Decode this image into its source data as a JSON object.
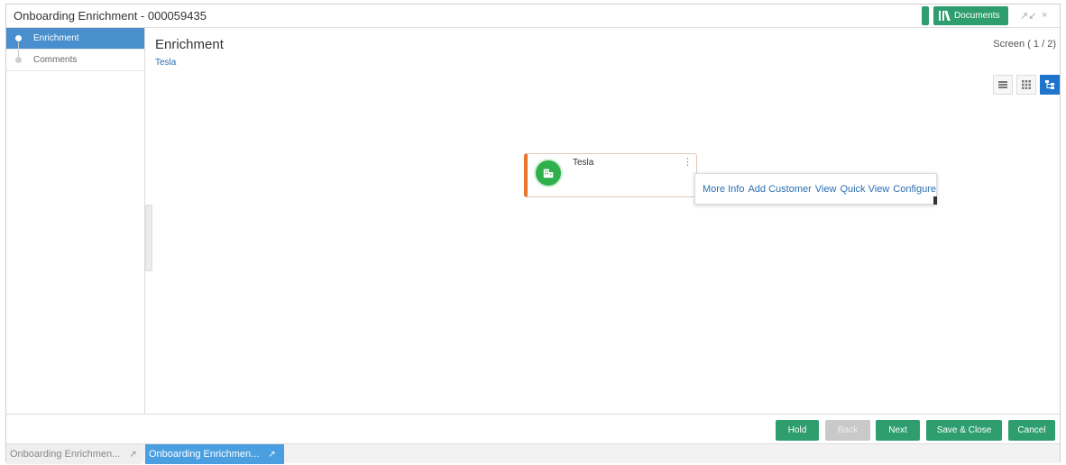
{
  "window": {
    "title": "Onboarding Enrichment - 000059435",
    "documents_label": "Documents",
    "minimize_glyph": "↗↙",
    "close_glyph": "×"
  },
  "sidebar": {
    "items": [
      {
        "label": "Enrichment",
        "active": true
      },
      {
        "label": "Comments",
        "active": false
      }
    ]
  },
  "main": {
    "title": "Enrichment",
    "subtitle": "Tesla",
    "screen_count": "Screen ( 1 / 2)",
    "view_toggle": [
      "list-view-icon",
      "grid-view-icon",
      "tree-view-icon"
    ],
    "node": {
      "label": "Tesla",
      "kebab": "⋮",
      "icon": "building-icon"
    },
    "context_menu": [
      "More Info",
      "Add Customer",
      "View",
      "Quick View",
      "Configure"
    ]
  },
  "footer": {
    "buttons": [
      "Hold",
      "Back",
      "Next",
      "Save & Close",
      "Cancel"
    ]
  },
  "taskbar": {
    "tasks": [
      "Onboarding Enrichmen...",
      "Onboarding Enrichmen..."
    ]
  },
  "colors": {
    "primary_green": "#2e9e6f",
    "nav_active": "#4a8fcd",
    "node_accent": "#e8762c",
    "node_avatar": "#2fb04b",
    "link_blue": "#2a6fb2"
  }
}
